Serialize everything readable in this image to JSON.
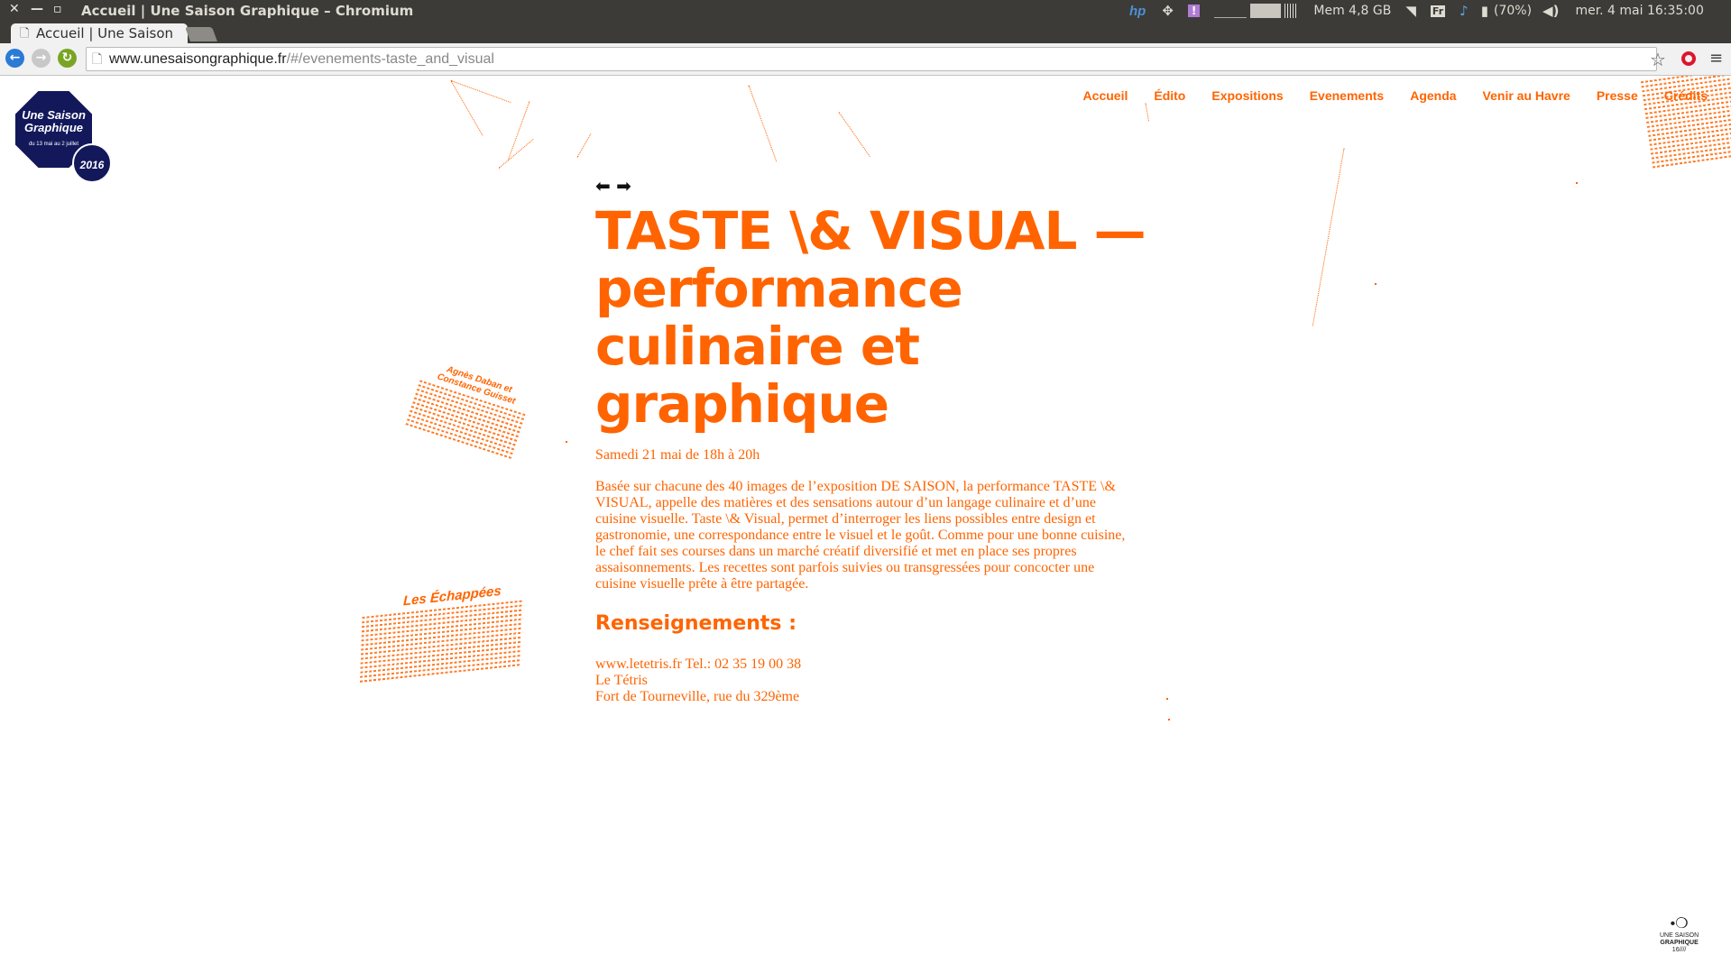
{
  "os_panel": {
    "window_title": "Accueil | Une Saison Graphique – Chromium",
    "memory": "Mem 4,8 GB",
    "battery": "(70%)",
    "clock": "mer.  4 mai 16:35:00"
  },
  "browser": {
    "tab_title": "Accueil | Une Saison",
    "url_host": "www.unesaisongraphique.fr",
    "url_path": "/#/evenements-taste_and_visual"
  },
  "logo": {
    "line1": "Une Saison",
    "line2": "Graphique",
    "dates": "du 13 mai au 2 juillet",
    "year": "2016"
  },
  "nav": {
    "items": [
      "Accueil",
      "Édito",
      "Expositions",
      "Evenements",
      "Agenda",
      "Venir au Havre",
      "Presse",
      "Crédits"
    ]
  },
  "event": {
    "arrows": "⬅ ➡",
    "title": "TASTE \\& VISUAL — performance culinaire et graphique",
    "date": "Samedi 21 mai de 18h à 20h",
    "description": "Basée sur chacune des 40 images de l’exposition DE SAISON, la performance TASTE \\& VISUAL, appelle des matières et des sensations autour d’un langage culinaire et d’une cuisine visuelle. Taste \\& Visual, permet d’interroger les liens possibles entre design et gastronomie, une correspondance entre le visuel et le goût. Comme pour une bonne cuisine, le chef fait ses courses dans un marché créatif diversifié et met en place ses propres assaisonnements. Les recettes sont parfois suivies ou transgressées pour concocter une cuisine visuelle prête à être partagée.",
    "info_heading": "Renseignements :",
    "contact_line1": "www.letetris.fr Tel.: 02 35 19 00 38",
    "contact_line2": "Le Tétris",
    "contact_line3": "Fort de Tourneville, rue du 329ème"
  },
  "decor": {
    "paper1_title": "Agnès Daban et Constance Guisset",
    "paper2_title": "Les Échappées"
  },
  "footer_logo": {
    "line1": "UNE SAISON",
    "line2": "GRAPHIQUE",
    "line3": "16////"
  },
  "colors": {
    "accent": "#ff6400",
    "logo_navy": "#12185a",
    "os_panel": "#3c3b37"
  },
  "icons": [
    "close-icon",
    "minimize-icon",
    "maximize-icon",
    "hp-icon",
    "dropbox-icon",
    "notification-icon",
    "wifi-icon",
    "keyboard-icon",
    "bell-icon",
    "battery-icon",
    "volume-icon",
    "back-icon",
    "forward-icon",
    "reload-icon",
    "page-icon",
    "star-icon",
    "opera-icon",
    "menu-icon"
  ]
}
